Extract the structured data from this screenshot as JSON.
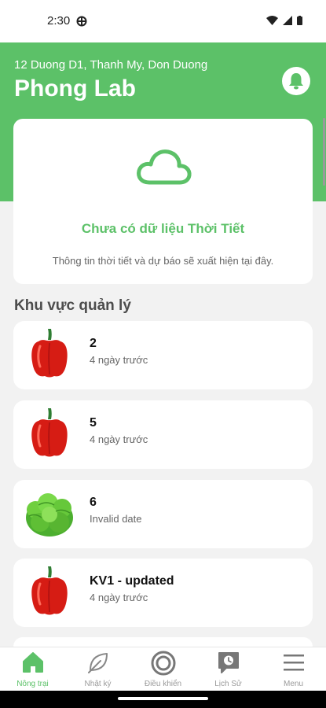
{
  "status_bar": {
    "time": "2:30"
  },
  "header": {
    "address": "12 Duong D1, Thanh My, Don Duong",
    "title": "Phong Lab"
  },
  "weather": {
    "title": "Chưa có dữ liệu Thời Tiết",
    "subtitle": "Thông tin thời tiết và dự báo sẽ xuất hiện tại đây."
  },
  "zones": {
    "section_title": "Khu vực quản lý",
    "items": [
      {
        "name": "2",
        "time": "4 ngày trước",
        "image": "red-pepper"
      },
      {
        "name": "5",
        "time": "4 ngày trước",
        "image": "red-pepper"
      },
      {
        "name": "6",
        "time": "Invalid date",
        "image": "lettuce"
      },
      {
        "name": "KV1 - updated",
        "time": "4 ngày trước",
        "image": "red-pepper"
      }
    ]
  },
  "nav": {
    "items": [
      {
        "label": "Nông trại",
        "icon": "home-icon",
        "active": true
      },
      {
        "label": "Nhật ký",
        "icon": "leaf-icon",
        "active": false
      },
      {
        "label": "Điều khiển",
        "icon": "target-icon",
        "active": false
      },
      {
        "label": "Lịch Sử",
        "icon": "history-icon",
        "active": false
      },
      {
        "label": "Menu",
        "icon": "menu-icon",
        "active": false
      }
    ]
  },
  "colors": {
    "primary": "#5cc168",
    "background": "#f2f2f2"
  }
}
